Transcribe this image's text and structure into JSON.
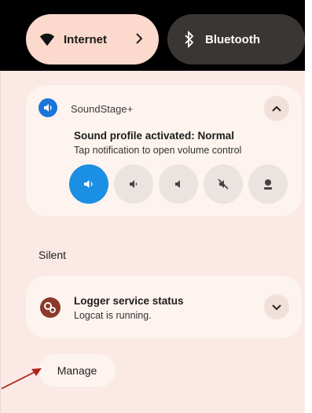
{
  "colors": {
    "accent": "#1a8fe3",
    "accent_soft": "#fbd9cc",
    "annotation": "#b0241c"
  },
  "quick_settings": {
    "internet": {
      "label": "Internet",
      "icon": "wifi-icon",
      "chevron": "chevron-right-icon"
    },
    "bluetooth": {
      "label": "Bluetooth",
      "icon": "bluetooth-icon"
    }
  },
  "sound_notification": {
    "app_icon": "soundstage-icon",
    "app_name": "SoundStage+",
    "title": "Sound profile activated: Normal",
    "subtitle": "Tap notification to open volume control",
    "modes": [
      {
        "icon": "speaker-normal-icon",
        "selected": true
      },
      {
        "icon": "speaker-low-icon",
        "selected": false
      },
      {
        "icon": "speaker-quiet-icon",
        "selected": false
      },
      {
        "icon": "speaker-mute-icon",
        "selected": false
      },
      {
        "icon": "headset-icon",
        "selected": false
      }
    ]
  },
  "silent_section": {
    "label": "Silent",
    "logger": {
      "icon": "gears-icon",
      "title": "Logger service status",
      "subtitle": "Logcat is running."
    }
  },
  "manage_label": "Manage"
}
